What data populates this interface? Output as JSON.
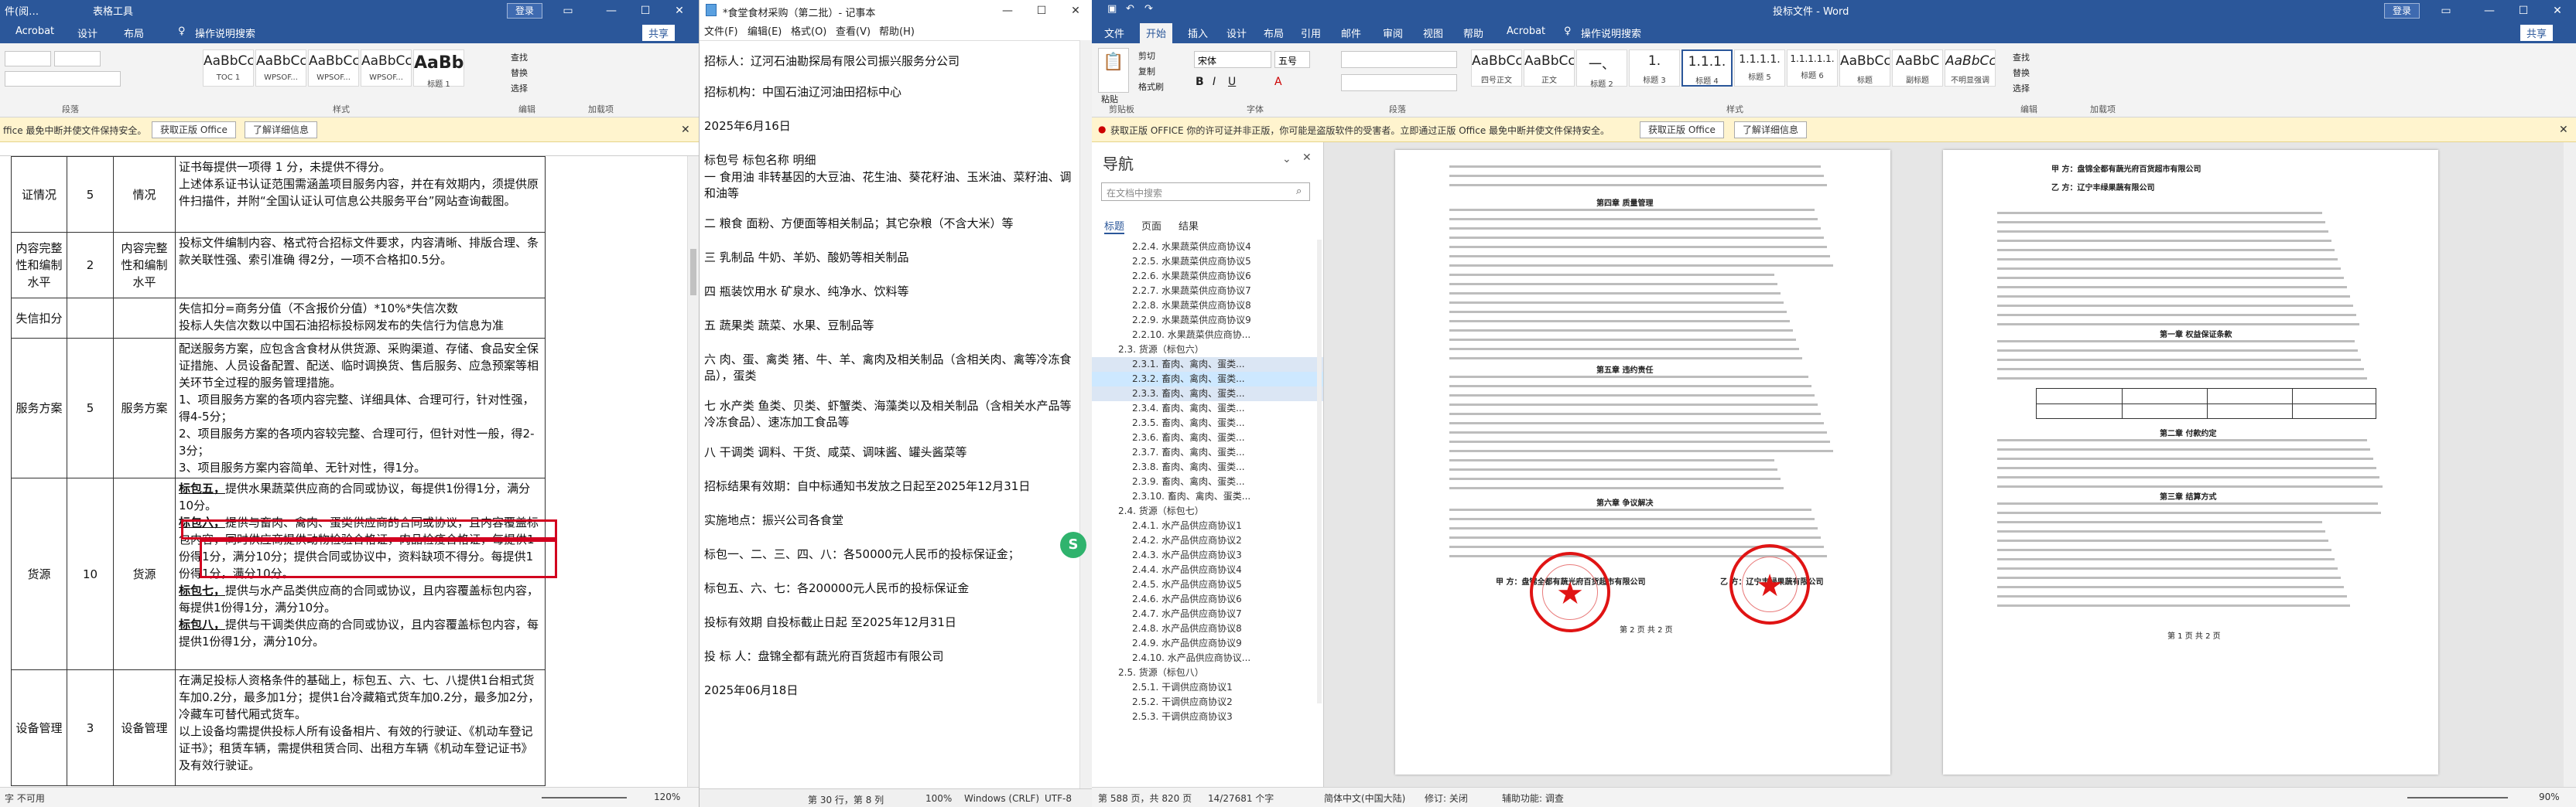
{
  "paneA": {
    "title_left": "件(阅…",
    "title_center": "表格工具",
    "login": "登录",
    "share": "共享",
    "tabs": [
      "Acrobat",
      "设计",
      "布局"
    ],
    "tell_me": "操作说明搜索",
    "toc_label": "TOC 1",
    "style_samples": [
      {
        "sample": "AaBbCcDd",
        "name": "TOC 1"
      },
      {
        "sample": "AaBbCcDc",
        "name": "WPSOF..."
      },
      {
        "sample": "AaBbCcDc",
        "name": "WPSOF..."
      },
      {
        "sample": "AaBbCcDc",
        "name": "WPSOF..."
      },
      {
        "sample": "AaBb",
        "name": "标题 1"
      }
    ],
    "edit_items": [
      "查找",
      "替换",
      "选择"
    ],
    "group_labels": [
      "段落",
      "样式",
      "编辑",
      "加载项"
    ],
    "msg_text": "ffice 最免中断并使文件保持安全。",
    "msg_btn1": "获取正版 Office",
    "msg_btn2": "了解详细信息",
    "rows": [
      {
        "item": "证情况",
        "score": "5",
        "type": "情况",
        "detail": "证书每提供一项得 1 分，未提供不得分。\n上述体系证书认证范围需涵盖项目服务内容，并在有效期内，须提供原件扫描件，并附“全国认证认可信息公共服务平台”网站查询截图。"
      },
      {
        "item": "内容完整性和编制水平",
        "score": "2",
        "type": "内容完整性和编制水平",
        "detail": "投标文件编制内容、格式符合招标文件要求，内容清晰、排版合理、条款关联性强、索引准确 得2分，一项不合格扣0.5分。"
      },
      {
        "item": "失信扣分",
        "score": "",
        "type": "",
        "detail": "失信扣分=商务分值（不含报价分值）*10%*失信次数\n投标人失信次数以中国石油招标投标网发布的失信行为信息为准"
      },
      {
        "item": "服务方案",
        "score": "5",
        "type": "服务方案",
        "detail": "配送服务方案，应包含含食材从供货源、采购渠道、存储、食品安全保证措施、人员设备配置、配送、临时调换货、售后服务、应急预案等相关环节全过程的服务管理措施。\n1、项目服务方案的各项内容完整、详细具体、合理可行，针对性强，得4-5分；\n2、项目服务方案的各项内容较完整、合理可行，但针对性一般，得2-3分；\n3、项目服务方案内容简单、无针对性，得1分。"
      },
      {
        "item": "货源",
        "score": "10",
        "type": "货源",
        "detail": ""
      },
      {
        "item": "设备管理",
        "score": "3",
        "type": "设备管理",
        "detail": "在满足投标人资格条件的基础上，标包五、六、七、八提供1台相式货车加0.2分，最多加1分；提供1台冷藏箱式货车加0.2分，最多加2分，冷藏车可替代厢式货车。\n以上设备均需提供投标人所有设备相片、有效的行驶证、《机动车登记证书》；租赁车辆，需提供租赁合同、出租方车辆《机动车登记证书》及有效行驶证。"
      }
    ],
    "huoyuan_criteria": [
      {
        "label": "标包五，",
        "text": "提供水果蔬菜供应商的合同或协议，每提供1份得1分，满分10分。"
      },
      {
        "label": "标包六，",
        "text": "提供与畜肉、禽肉、蛋类供应商的合同或协议，且内容覆盖标包内容，同时供应商提供动物检验合格证，肉品检疫合格证，每提供1份得1分，满分10分；提供合同或协议中，资料缺项不得分。每提供1份得1分，满分10分。"
      },
      {
        "label": "标包七，",
        "text": "提供与水产品类供应商的合同或协议，且内容覆盖标包内容，每提供1份得1分，满分10分。"
      },
      {
        "label": "标包八，",
        "text": "提供与干调类供应商的合同或协议，且内容覆盖标包内容，每提供1份得1分，满分10分。"
      }
    ],
    "status_text": "字 不可用",
    "zoom": "120%"
  },
  "notepad": {
    "title": "*食堂食材采购（第二批）- 记事本",
    "menu": [
      "文件(F)",
      "编辑(E)",
      "格式(O)",
      "查看(V)",
      "帮助(H)"
    ],
    "lines": [
      "招标人：辽河石油勘探局有限公司振兴服务分公司",
      "招标机构：中国石油辽河油田招标中心",
      "2025年6月16日",
      "标包号    标包名称  明细",
      "一  食用油  非转基因的大豆油、花生油、葵花籽油、玉米油、菜籽油、调和油等",
      "二  粮食    面粉、方便面等相关制品；其它杂粮（不含大米）等",
      "三  乳制品  牛奶、羊奶、酸奶等相关制品",
      "四  瓶装饮用水        矿泉水、纯净水、饮料等",
      "五  蔬果类  蔬菜、水果、豆制品等",
      "六  肉、蛋、禽类        猪、牛、羊、禽肉及相关制品（含相关肉、禽等冷冻食品），蛋类",
      "七  水产类  鱼类、贝类、虾蟹类、海藻类以及相关制品（含相关水产品等冷冻食品）、速冻加工食品等",
      "八  干调类  调料、干货、咸菜、调味酱、罐头酱菜等",
      "招标结果有效期：自中标通知书发放之日起至2025年12月31日",
      "实施地点：振兴公司各食堂",
      "标包一、二、三、四、八：各50000元人民币的投标保证金；",
      "标包五、六、七：各200000元人民币的投标保证金",
      "投标有效期    自投标截止日起 至2025年12月31日",
      "投 标 人：盘锦全都有蔬光府百货超市有限公司",
      "2025年06月18日"
    ],
    "status": [
      "第 30 行，第 8 列",
      "100%",
      "Windows (CRLF)",
      "UTF-8"
    ]
  },
  "paneC": {
    "title": "投标文件 - Word",
    "login": "登录",
    "share": "共享",
    "tabs": [
      "文件",
      "开始",
      "插入",
      "设计",
      "布局",
      "引用",
      "邮件",
      "审阅",
      "视图",
      "帮助",
      "Acrobat"
    ],
    "tell_me": "操作说明搜索",
    "clipboard": [
      "剪切",
      "复制",
      "格式刷"
    ],
    "paste": "粘贴",
    "font_name": "宋体",
    "font_size": "五号",
    "styles": [
      {
        "sample": "AaBbCc",
        "name": "四号正文"
      },
      {
        "sample": "AaBbCcDc",
        "name": "正文"
      },
      {
        "sample": "一、",
        "name": "标题 2"
      },
      {
        "sample": "1.",
        "name": "标题 3"
      },
      {
        "sample": "1.1.1.",
        "name": "标题 4"
      },
      {
        "sample": "1.1.1.1.",
        "name": "标题 5"
      },
      {
        "sample": "1.1.1.1.1.",
        "name": "标题 6"
      },
      {
        "sample": "AaBbCcDc",
        "name": "标题"
      },
      {
        "sample": "AaBbC",
        "name": "副标题"
      },
      {
        "sample": "AaBbCcDc",
        "name": "不明显强调"
      }
    ],
    "edit_items": [
      "查找",
      "替换",
      "选择"
    ],
    "group_labels": [
      "剪贴板",
      "字体",
      "段落",
      "样式",
      "编辑",
      "加载项"
    ],
    "msg_text": "获取正版 OFFICE   你的许可证并非正版，你可能是盗版软件的受害者。立即通过正版 Office 最免中断并使文件保持安全。",
    "msg_btn1": "获取正版 Office",
    "msg_btn2": "了解详细信息",
    "nav_title": "导航",
    "nav_search": "在文档中搜索",
    "nav_tabs": [
      "标题",
      "页面",
      "结果"
    ],
    "nav_items": [
      "2.2.4. 水果蔬菜供应商协议4",
      "2.2.5. 水果蔬菜供应商协议5",
      "2.2.6. 水果蔬菜供应商协议6",
      "2.2.7. 水果蔬菜供应商协议7",
      "2.2.8. 水果蔬菜供应商协议8",
      "2.2.9. 水果蔬菜供应商协议9",
      "2.2.10. 水果蔬菜供应商协...",
      "2.3. 货源（标包六）",
      "2.3.1. 畜肉、禽肉、蛋类...",
      "2.3.2. 畜肉、禽肉、蛋类...",
      "2.3.3. 畜肉、禽肉、蛋类...",
      "2.3.4. 畜肉、禽肉、蛋类...",
      "2.3.5. 畜肉、禽肉、蛋类...",
      "2.3.6. 畜肉、禽肉、蛋类...",
      "2.3.7. 畜肉、禽肉、蛋类...",
      "2.3.8. 畜肉、禽肉、蛋类...",
      "2.3.9. 畜肉、禽肉、蛋类...",
      "2.3.10. 畜肉、禽肉、蛋类...",
      "2.4. 货源（标包七）",
      "2.4.1. 水产品供应商协议1",
      "2.4.2. 水产品供应商协议2",
      "2.4.3. 水产品供应商协议3",
      "2.4.4. 水产品供应商协议4",
      "2.4.5. 水产品供应商协议5",
      "2.4.6. 水产品供应商协议6",
      "2.4.7. 水产品供应商协议7",
      "2.4.8. 水产品供应商协议8",
      "2.4.9. 水产品供应商协议9",
      "2.4.10. 水产品供应商协议...",
      "2.5. 货源（标包八）",
      "2.5.1. 干调供应商协议1",
      "2.5.2. 干调供应商协议2",
      "2.5.3. 干调供应商协议3"
    ],
    "page1": {
      "sec4": "第四章  质量管理",
      "sec5": "第五章  违约责任",
      "sec6": "第六章  争议解决",
      "partyA": "甲  方：盘锦全都有蔬光府百货超市有限公司",
      "partyB": "乙  方：辽宁丰绿果蔬有限公司",
      "pageno": "第 2 页 共 2 页"
    },
    "page2": {
      "partyA": "甲  方：盘锦全都有蔬光府百货超市有限公司",
      "partyB": "乙  方：辽宁丰绿果蔬有限公司",
      "sec1": "第一章  权益保证条款",
      "sec2": "第二章  付款约定",
      "sec3": "第三章  结算方式",
      "pageno": "第 1 页 共 2 页"
    },
    "status": [
      "第 588 页，共 820 页",
      "14/27681 个字",
      "简体中文(中国大陆)",
      "修订: 关闭",
      "辅助功能: 调查"
    ],
    "zoom": "90%"
  }
}
